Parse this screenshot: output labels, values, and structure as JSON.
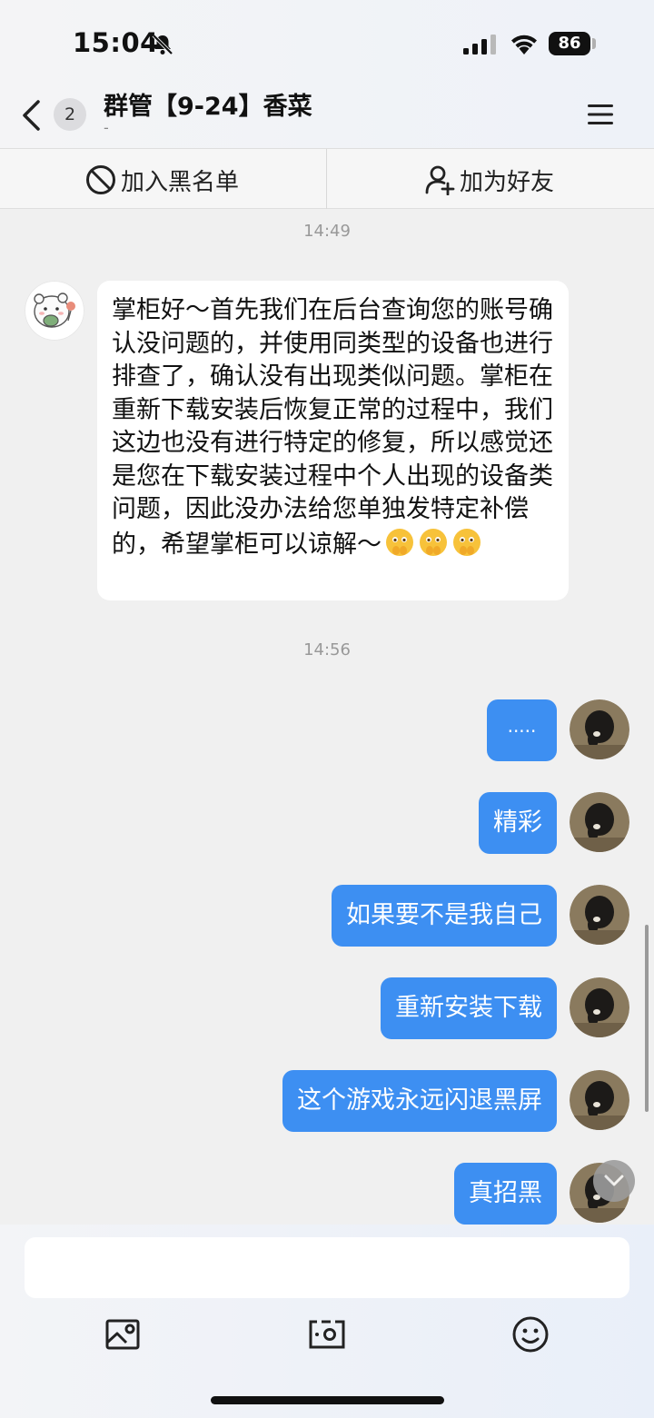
{
  "status_bar": {
    "time": "15:04",
    "battery": "86",
    "icons": [
      "bell-muted-icon",
      "signal-icon",
      "wifi-icon",
      "battery-icon"
    ]
  },
  "nav": {
    "unread_count": "2",
    "title": "群管【9-24】香菜",
    "subtitle": "-"
  },
  "actions": {
    "block_label": "加入黑名单",
    "add_friend_label": "加为好友"
  },
  "messages": {
    "time_1": "14:49",
    "incoming_text": "掌柜好～首先我们在后台查询您的账号确认没问题的，并使用同类型的设备也进行排查了，确认没有出现类似问题。掌柜在重新下载安装后恢复正常的过程中，我们这边也没有进行特定的修复，所以感觉还是您在下载安装过程中个人出现的设备类问题，因此没办法给您单独发特定补偿的，希望掌柜可以谅解～",
    "time_2": "14:56",
    "outgoing": [
      "·····",
      "精彩",
      "如果要不是我自己",
      "重新安装下载",
      "这个游戏永远闪退黑屏",
      "真招黑"
    ]
  },
  "composer": {
    "placeholder": "",
    "tools": [
      "image-icon",
      "camera-icon",
      "emoji-icon"
    ]
  },
  "colors": {
    "bubble_out": "#3d8ff2",
    "bubble_in": "#ffffff",
    "background": "#f0f0f0"
  }
}
